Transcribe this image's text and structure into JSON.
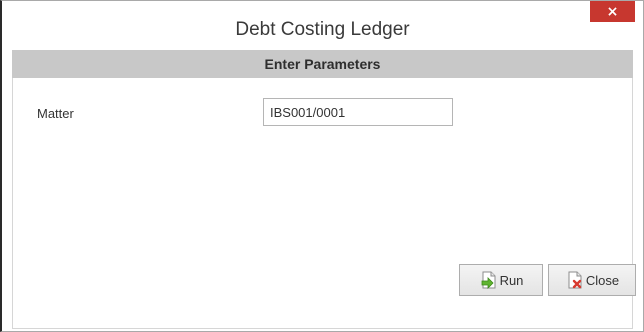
{
  "window": {
    "title": "Debt Costing Ledger",
    "close_label": "×"
  },
  "params": {
    "header": "Enter Parameters",
    "matter_label": "Matter",
    "matter_value": "IBS001/0001"
  },
  "buttons": {
    "run_label": "Run",
    "close_label": "Close"
  },
  "icons": {
    "run": "document-run-icon",
    "close": "document-close-icon"
  },
  "colors": {
    "close_button": "#c7372f",
    "header_bar": "#c8c8c8"
  }
}
